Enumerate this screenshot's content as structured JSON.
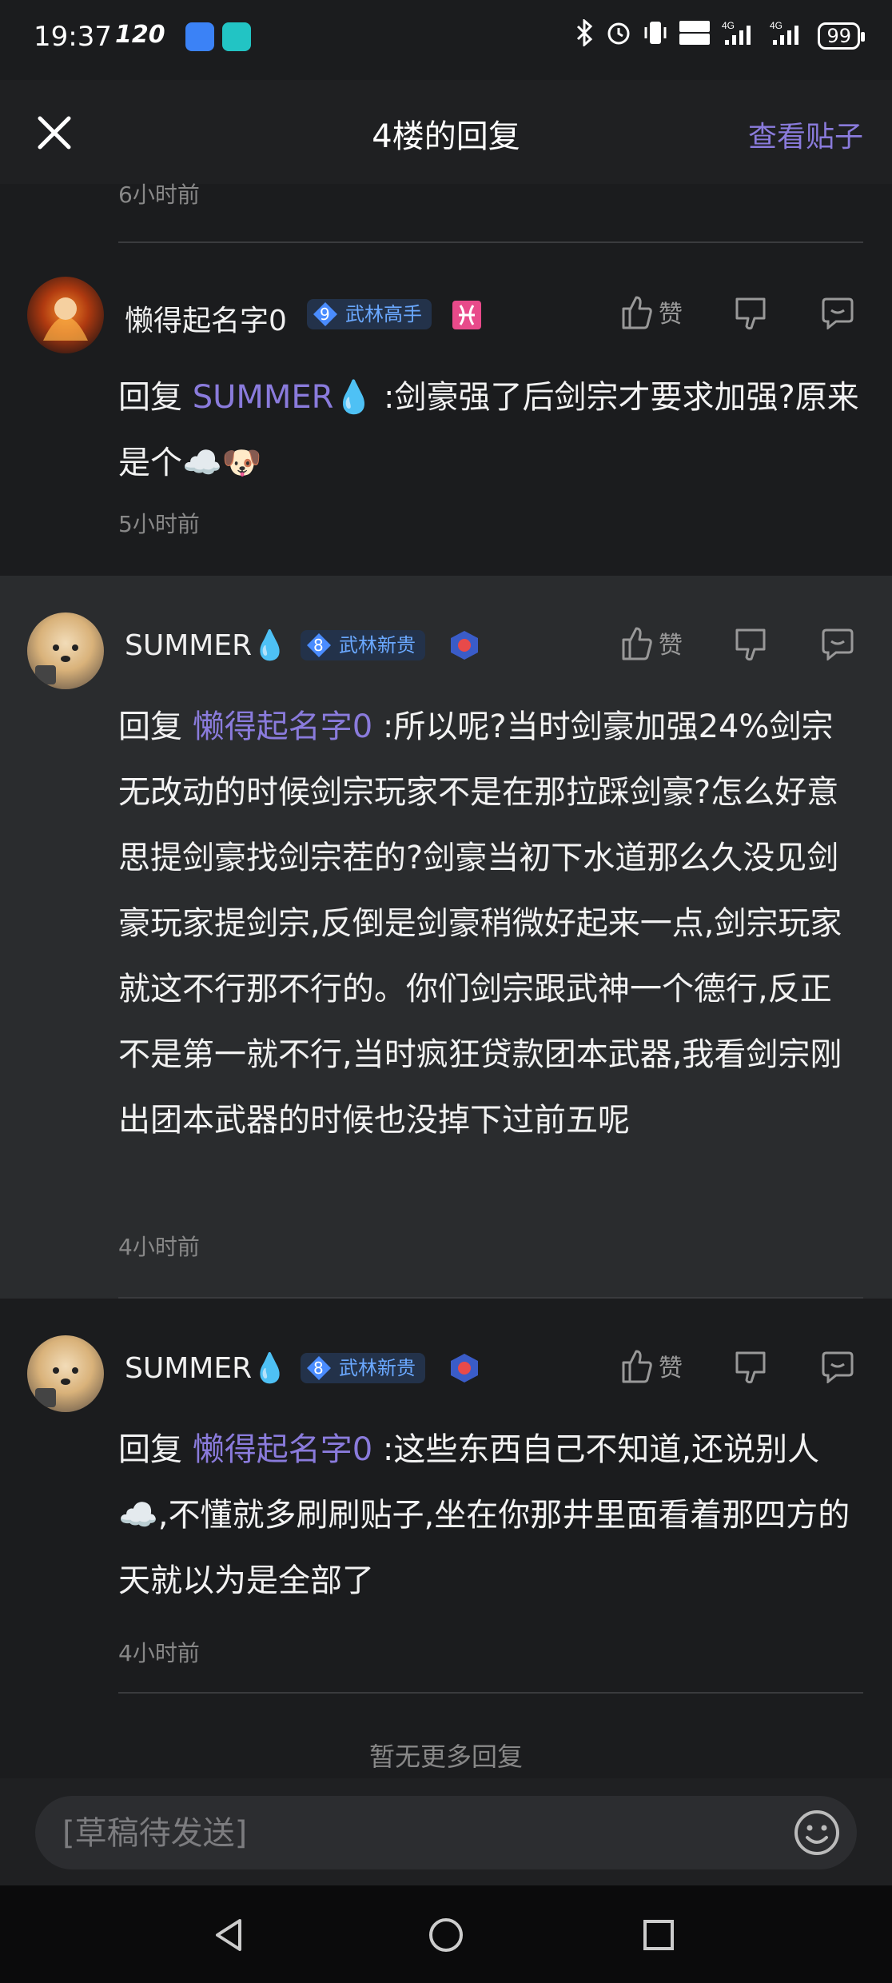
{
  "status_bar": {
    "time": "19:37",
    "refresh_rate": "120",
    "battery": "99",
    "icons": [
      "bluetooth-icon",
      "alarm-icon",
      "vibrate-icon",
      "hd-icon",
      "signal-4g-icon",
      "signal-4g-icon",
      "battery-icon"
    ]
  },
  "header": {
    "title": "4楼的回复",
    "view_post": "查看贴子"
  },
  "previous_time": "6小时前",
  "comments": [
    {
      "username": "懒得起名字0",
      "level": "9",
      "rank": "武林高手",
      "like_label": "赞",
      "reply_prefix": "回复",
      "mention": "SUMMER💧",
      "text": " :剑豪强了后剑宗才要求加强?原来是个☁️🐶",
      "time": "5小时前"
    },
    {
      "username": "SUMMER💧",
      "level": "8",
      "rank": "武林新贵",
      "like_label": "赞",
      "reply_prefix": "回复",
      "mention": "懒得起名字0",
      "text": " :所以呢?当时剑豪加强24%剑宗无改动的时候剑宗玩家不是在那拉踩剑豪?怎么好意思提剑豪找剑宗茬的?剑豪当初下水道那么久没见剑豪玩家提剑宗,反倒是剑豪稍微好起来一点,剑宗玩家就这不行那不行的。你们剑宗跟武神一个德行,反正不是第一就不行,当时疯狂贷款团本武器,我看剑宗刚出团本武器的时候也没掉下过前五呢",
      "time": "4小时前"
    },
    {
      "username": "SUMMER💧",
      "level": "8",
      "rank": "武林新贵",
      "like_label": "赞",
      "reply_prefix": "回复",
      "mention": "懒得起名字0",
      "text": " :这些东西自己不知道,还说别人☁️,不懂就多刷刷贴子,坐在你那井里面看着那四方的天就以为是全部了",
      "time": "4小时前"
    }
  ],
  "no_more": "暂无更多回复",
  "input": {
    "placeholder": "[草稿待发送]"
  },
  "colors": {
    "accent": "#8a7bdc",
    "background": "#1b1c1e",
    "highlight": "#2a2c2e",
    "badge_text": "#6aa8ff"
  }
}
